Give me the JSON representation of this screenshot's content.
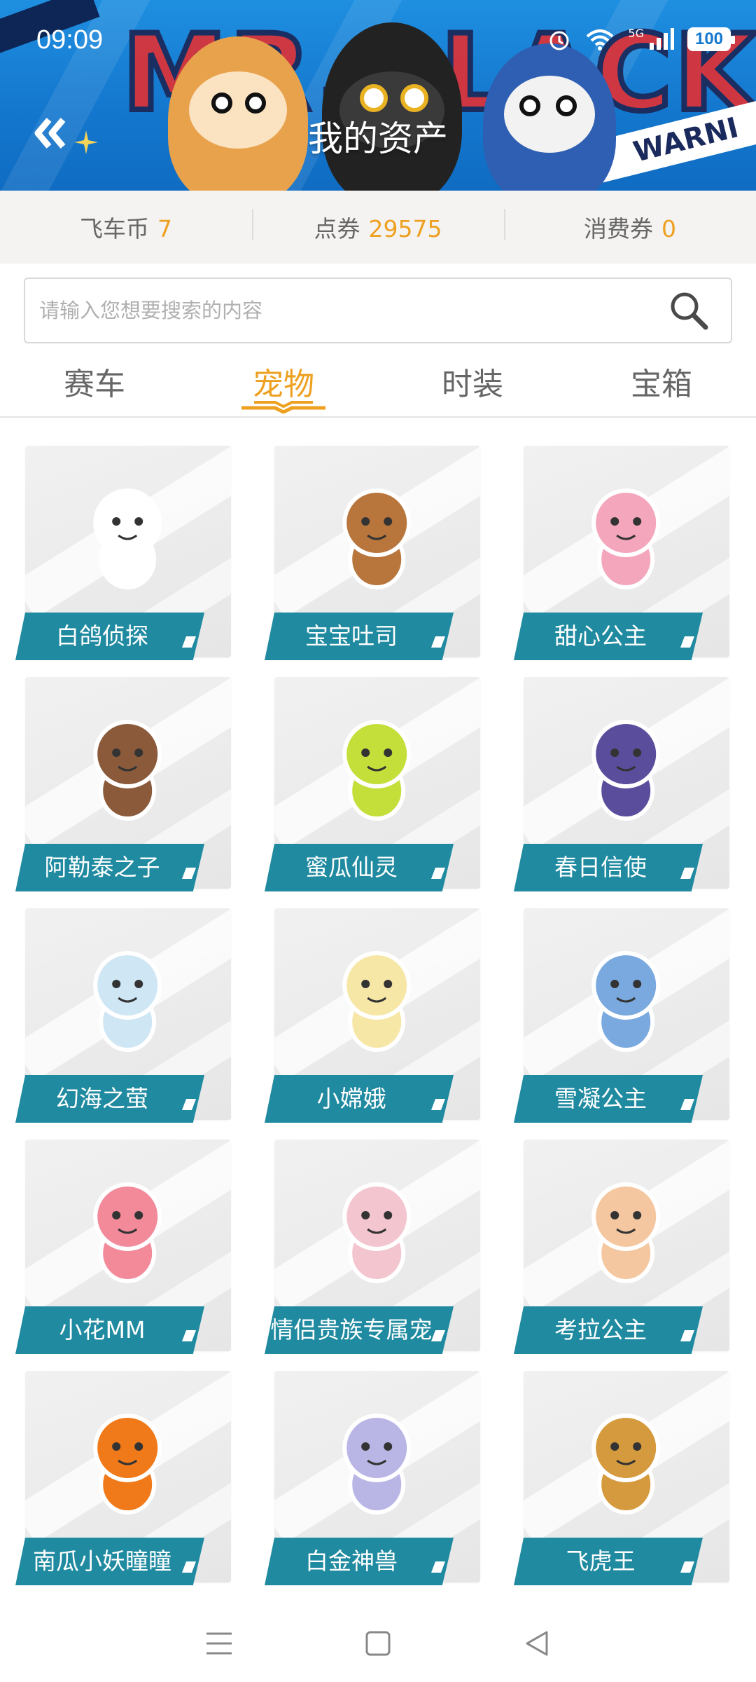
{
  "status_bar": {
    "time": "09:09",
    "network": "5G",
    "battery": "100"
  },
  "banner": {
    "text": "MR.BLACK",
    "side_text": "WARNI"
  },
  "header": {
    "title": "我的资产"
  },
  "currencies": [
    {
      "label": "飞车币",
      "value": "7"
    },
    {
      "label": "点券",
      "value": "29575"
    },
    {
      "label": "消费券",
      "value": "0"
    }
  ],
  "search": {
    "placeholder": "请输入您想要搜索的内容"
  },
  "tabs": [
    {
      "label": "赛车",
      "active": false
    },
    {
      "label": "宠物",
      "active": true
    },
    {
      "label": "时装",
      "active": false
    },
    {
      "label": "宝箱",
      "active": false
    }
  ],
  "pets": [
    {
      "name": "白鸽侦探",
      "icon": "white-dove-icon",
      "color": "#ffffff"
    },
    {
      "name": "宝宝吐司",
      "icon": "toast-cookie-icon",
      "color": "#b8753c"
    },
    {
      "name": "甜心公主",
      "icon": "pink-princess-icon",
      "color": "#f4a6bc"
    },
    {
      "name": "阿勒泰之子",
      "icon": "horse-rider-icon",
      "color": "#8a5a3b"
    },
    {
      "name": "蜜瓜仙灵",
      "icon": "melon-spirit-icon",
      "color": "#c4df3a"
    },
    {
      "name": "春日信使",
      "icon": "penguin-messenger-icon",
      "color": "#5a4e9c"
    },
    {
      "name": "幻海之萤",
      "icon": "sea-firefly-icon",
      "color": "#cfe6f5"
    },
    {
      "name": "小嫦娥",
      "icon": "moon-fairy-icon",
      "color": "#f7e7a7"
    },
    {
      "name": "雪凝公主",
      "icon": "snow-princess-icon",
      "color": "#7aa9e0"
    },
    {
      "name": "小花MM",
      "icon": "flower-girl-icon",
      "color": "#f28a9a"
    },
    {
      "name": "情侣贵族专属宠",
      "icon": "noble-couple-icon",
      "color": "#f3c6cf"
    },
    {
      "name": "考拉公主",
      "icon": "koala-princess-icon",
      "color": "#f5c7a0"
    },
    {
      "name": "南瓜小妖瞳瞳",
      "icon": "pumpkin-imp-icon",
      "color": "#f07a1a"
    },
    {
      "name": "白金神兽",
      "icon": "platinum-beast-icon",
      "color": "#b9b6e6"
    },
    {
      "name": "飞虎王",
      "icon": "tiger-king-icon",
      "color": "#d69a3e"
    }
  ],
  "colors": {
    "accent": "#eea020",
    "label_bg": "#1f8aa0",
    "header_bg": "#1478cf"
  }
}
